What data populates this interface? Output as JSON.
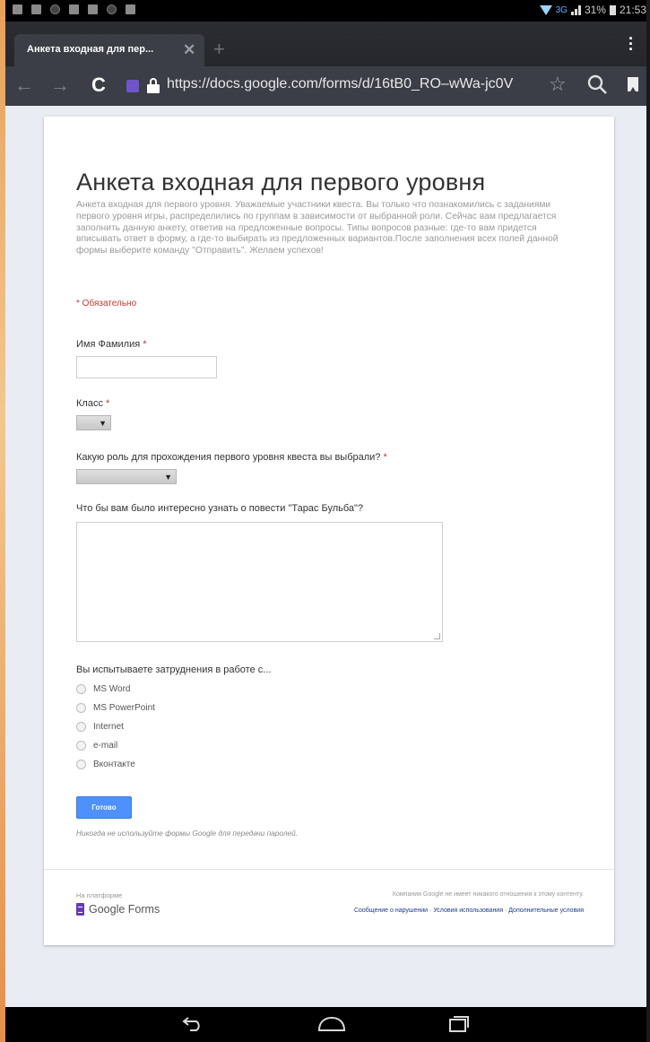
{
  "status_bar": {
    "network": "3G",
    "battery": "31%",
    "time": "21:53"
  },
  "tab": {
    "title": "Анкета входная для пер...",
    "close_icon": "close-icon",
    "new_tab_icon": "plus-icon"
  },
  "address_bar": {
    "url": "https://docs.google.com/forms/d/16tB0_RO–wWa-jc0V"
  },
  "form": {
    "title": "Анкета входная для первого уровня",
    "description": "Анкета входная для первого уровня. Уважаемые участники квеста. Вы только что познакомились с заданиями первого уровня игры, распределились по группам в зависимости от выбранной роли. Сейчас вам предлагается заполнить данную анкету, ответив на предложенные вопросы. Типы вопросов разные: где-то вам придется вписывать ответ в форму, а где-то выбирать из предложенных вариантов.После заполнения всех полей данной формы выберите команду \"Отправить\". Желаем успехов!",
    "required_note": "* Обязательно",
    "questions": {
      "name": {
        "label": "Имя Фамилия",
        "required_mark": "*",
        "value": ""
      },
      "class": {
        "label": "Класс",
        "required_mark": "*",
        "selected": ""
      },
      "role": {
        "label": "Какую роль для прохождения первого уровня квеста вы выбрали?",
        "required_mark": "*",
        "selected": ""
      },
      "interest": {
        "label": "Что бы вам было интересно узнать о повести \"Тарас Бульба\"?",
        "value": ""
      },
      "difficulties": {
        "label": "Вы испытываете затруднения в работе с...",
        "options": [
          "MS Word",
          "MS PowerPoint",
          "Internet",
          "e-mail",
          "Вконтакте"
        ]
      }
    },
    "submit_label": "Готово",
    "password_warning": "Никогда не используйте формы Google для передачи паролей."
  },
  "footer": {
    "powered_by": "На платформе",
    "brand": "Google Forms",
    "disclaimer": "Компания Google не имеет никакого отношения к этому контенту.",
    "links": "Сообщение о нарушении · Условия использования · Дополнительные условия"
  },
  "colors": {
    "accent_button": "#4d90fe",
    "required": "#c0392b",
    "forms_brand": "#673ab7"
  }
}
